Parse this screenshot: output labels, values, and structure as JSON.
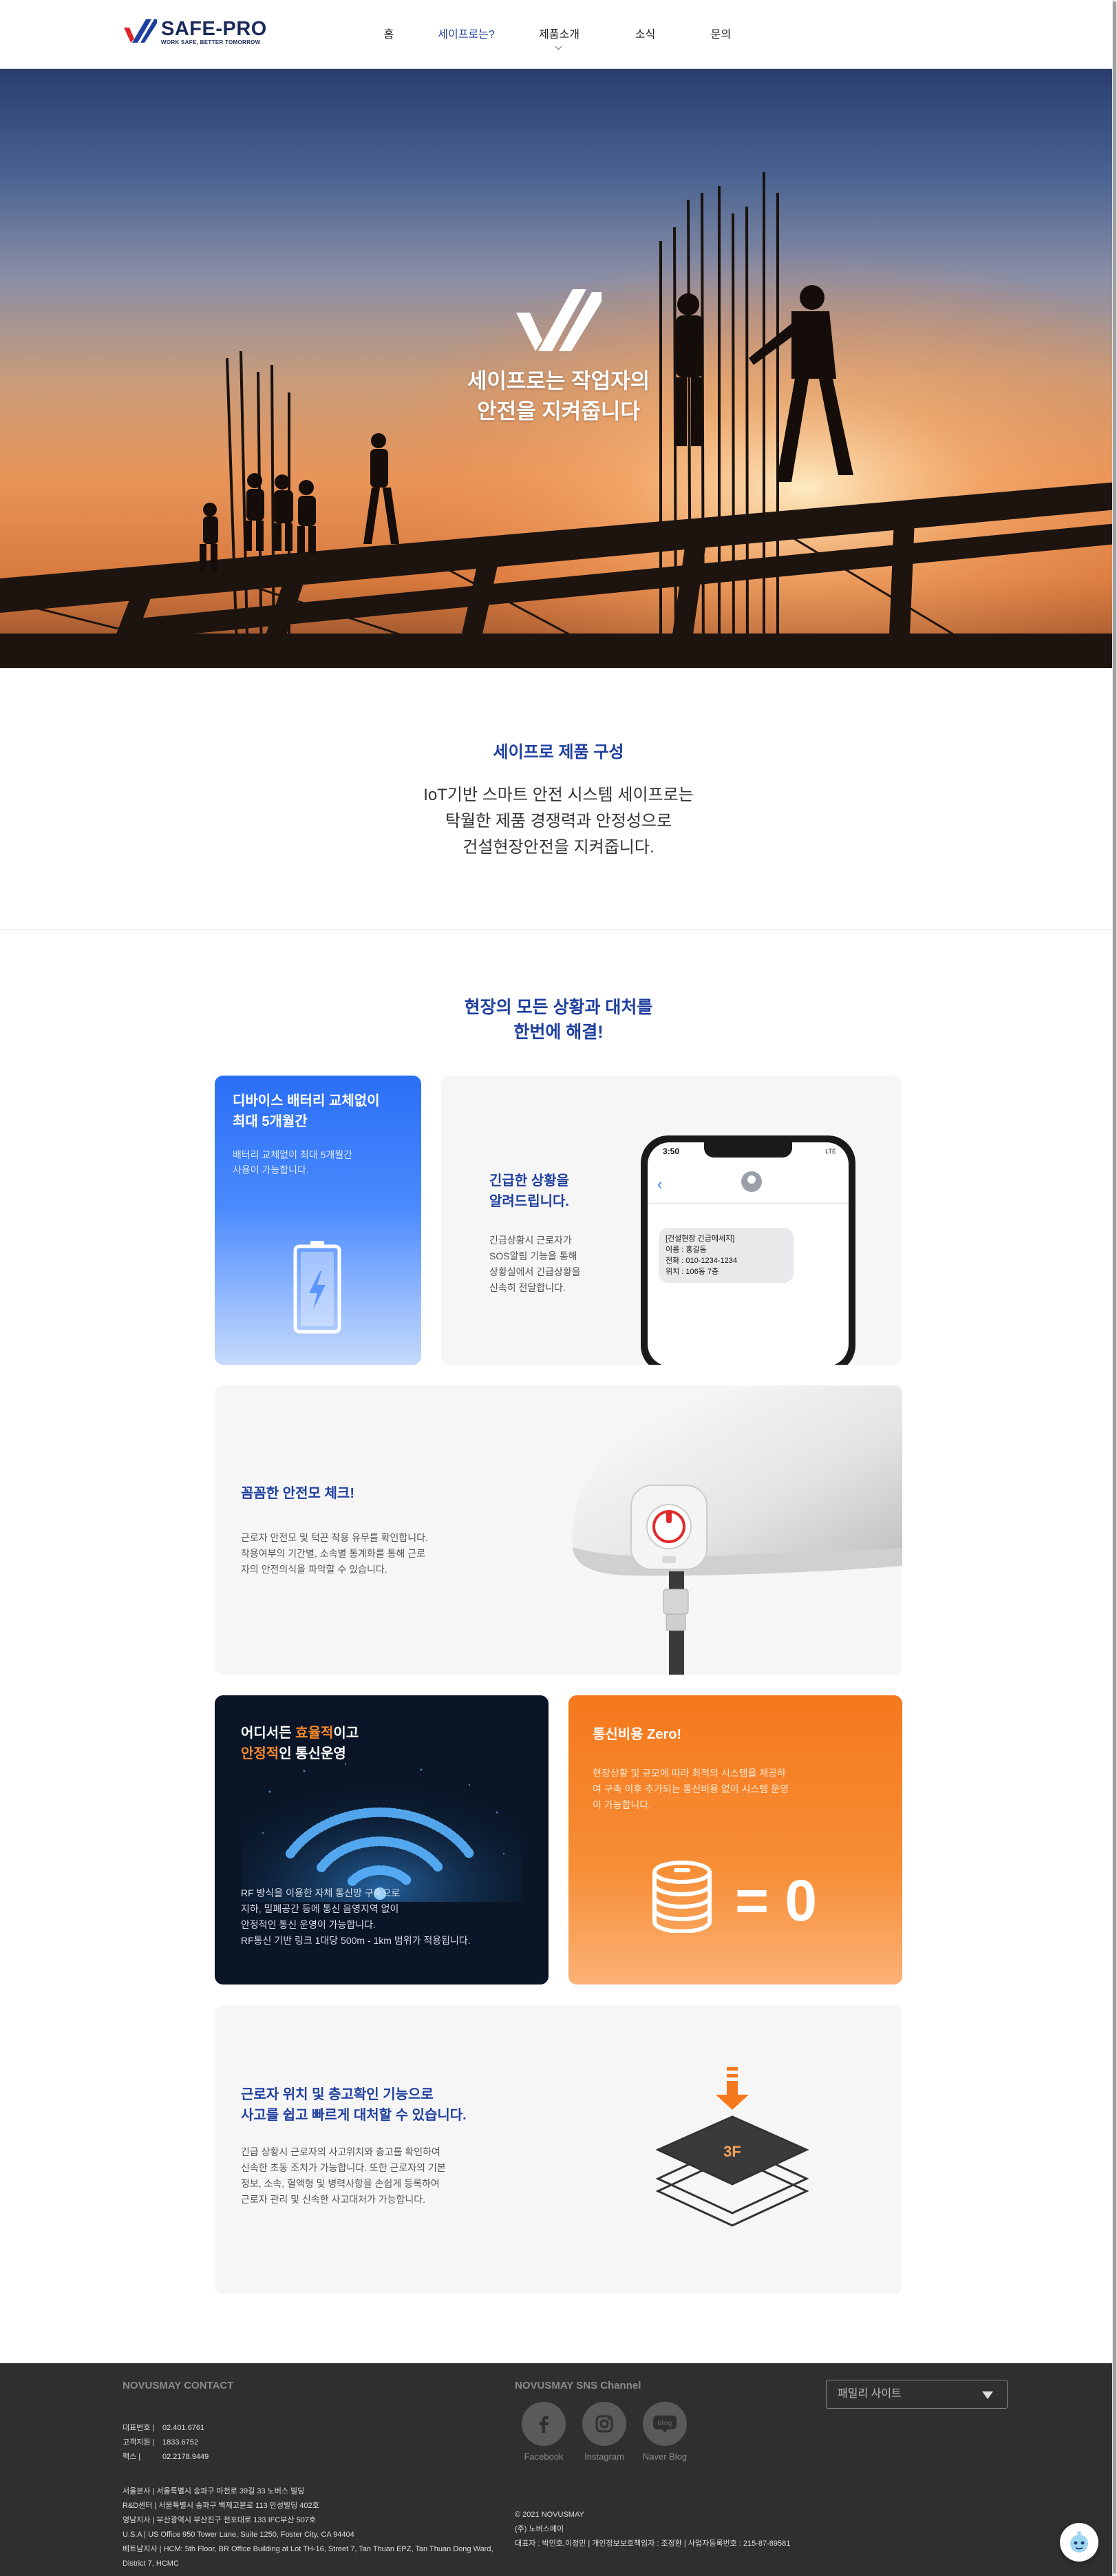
{
  "header": {
    "logo_title": "SAFE-PRO",
    "logo_sub": "WORK SAFE, BETTER TOMORROW",
    "nav": [
      {
        "label": "홈"
      },
      {
        "label": "세이프로는?"
      },
      {
        "label": "제품소개"
      },
      {
        "label": "소식"
      },
      {
        "label": "문의"
      }
    ]
  },
  "hero": {
    "line1": "세이프로는 작업자의",
    "line2": "안전을 지켜줍니다"
  },
  "intro": {
    "title": "세이프로 제품 구성",
    "line1": "IoT기반 스마트 안전 시스템 세이프로는",
    "line2": "탁월한 제품 경쟁력과 안정성으로",
    "line3": "건설현장안전을 지켜줍니다."
  },
  "section": {
    "title1": "현장의 모든 상황과 대처를",
    "title2": "한번에 해결!"
  },
  "cards": {
    "battery": {
      "title1": "디바이스 배터리 교체없이",
      "title2": "최대 5개월간",
      "desc1": "배터리 교체없이 최대 5개월간",
      "desc2": "사용이 가능합니다."
    },
    "sos": {
      "title1": "긴급한 상황을",
      "title2": "알려드립니다.",
      "desc1": "긴급상황시 근로자가",
      "desc2": "SOS알림 기능을 통해",
      "desc3": "상황실에서 긴급상황을",
      "desc4": "신속히 전달합니다.",
      "phone_time": "3:50",
      "phone_status": "LTE",
      "msg1": "[건설현장 긴급메세지]",
      "msg2": "이름 : 홍길동",
      "msg3": "전화 : 010-1234-1234",
      "msg4": "위치 : 106동 7층"
    },
    "helmet": {
      "title": "꼼꼼한 안전모 체크!",
      "desc1": "근로자 안전모 및 턱끈 착용 유무를 확인합니다.",
      "desc2": "착용여부의 기간별, 소속별 통계화를 통해 근로",
      "desc3": "자의 안전의식을 파악할 수 있습니다."
    },
    "comm": {
      "title_a": "어디서든 ",
      "title_hl1": "효율적",
      "title_b": "이고",
      "title_hl2": "안정적",
      "title_c": "인 통신운영",
      "desc1": "RF 방식을 이용한 자체 통신망 구축으로",
      "desc2": "지하, 밀폐공간 등에 통신 음영지역 없이",
      "desc3": "안정적인 통신 운영이 가능합니다.",
      "desc4": "RF통신 기반 링크 1대당 500m - 1km 범위가 적용됩니다."
    },
    "cost": {
      "title": "통신비용 Zero!",
      "desc1": "현장상황 및 규모에 따라 최적의 시스템을 제공하",
      "desc2": "여 구축 이후 추가되는 통신비용 없이 시스템 운영",
      "desc3": "이 가능합니다.",
      "equation": "= 0"
    },
    "location": {
      "title1": "근로자 위치 및 층고확인 기능으로",
      "title2": "사고를 쉽고 빠르게 대처할 수 있습니다.",
      "desc1": "긴급 상황시 근로자의 사고위치와 층고를 확인하여",
      "desc2": "신속한 초동 조치가 가능합니다. 또한 근로자의 기본",
      "desc3": "정보, 소속, 혈액형 및 병력사항을 손쉽게 등록하여",
      "desc4": "근로자 관리 및 신속한 사고대처가 가능합니다.",
      "floor_label": "3F"
    }
  },
  "footer": {
    "contact_head": "NOVUSMAY CONTACT",
    "sns_head": "NOVUSMAY SNS Channel",
    "contacts": [
      {
        "label": "대표번호  |",
        "value": "02.401.6761"
      },
      {
        "label": "고객지원  |",
        "value": "1833.6752"
      },
      {
        "label": "팩스  |",
        "value": "02.2178.9449"
      }
    ],
    "addresses": [
      "서울본사  |   서울특별시 송파구 마천로 39길 33 노버스 빌딩",
      "R&D센터  |   서울특별시 송파구 백제고분로 113 안성빌딩 402호",
      "영남지사  |   부산광역시 부산진구 전포대로 133 IFC부산 507호",
      "U.S.A  |   US Office 950 Tower Lane, Suite 1250, Foster City, CA 94404",
      "베트남지사  |   HCM: 5th Floor, BR Office Building at Lot TH-16, Street 7, Tan Thuan EPZ, Tan Thuan Dong Ward,",
      "District 7, HCMC"
    ],
    "sns": [
      {
        "label": "Facebook"
      },
      {
        "label": "Instagram"
      },
      {
        "label": "Naver Blog"
      }
    ],
    "corp1": "© 2021 NOVUSMAY",
    "corp2": "(주) 노버스메이",
    "corp3": "대표자 : 박민호,이정민   |   개인정보보호책임자 : 조정환   |   사업자등록번호 : 215-87-89581",
    "family_label": "패밀리 사이트"
  },
  "colors": {
    "brand_blue": "#1f3fa0",
    "accent_orange": "#f5781c",
    "footer_bg": "#2f2f2f"
  }
}
